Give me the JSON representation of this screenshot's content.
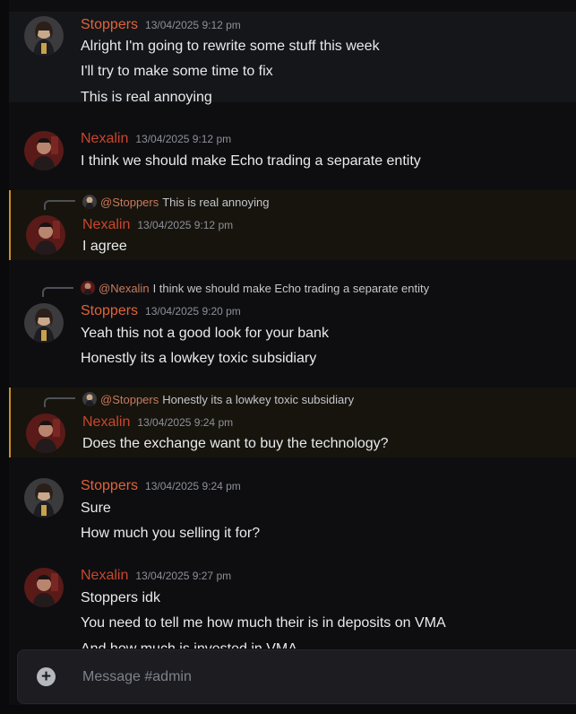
{
  "composer": {
    "placeholder": "Message #admin",
    "add_icon": "plus-circle-icon"
  },
  "messages": [
    {
      "author": "Stoppers",
      "timestamp": "13/04/2025 9:12 pm",
      "lines": [
        "Alright I'm going to rewrite some stuff this week",
        "I'll try to make some time to fix",
        "This is real annoying"
      ]
    },
    {
      "author": "Nexalin",
      "timestamp": "13/04/2025 9:12 pm",
      "lines": [
        "I think we should make Echo trading a separate entity"
      ]
    },
    {
      "reply_to": {
        "author": "@Stoppers",
        "text": "This is real annoying"
      },
      "author": "Nexalin",
      "timestamp": "13/04/2025 9:12 pm",
      "lines": [
        "I agree"
      ]
    },
    {
      "reply_to": {
        "author": "@Nexalin",
        "text": "I think we should make Echo trading a separate entity"
      },
      "author": "Stoppers",
      "timestamp": "13/04/2025 9:20 pm",
      "lines": [
        "Yeah this not a good look for your bank",
        "Honestly its a lowkey toxic subsidiary"
      ]
    },
    {
      "reply_to": {
        "author": "@Stoppers",
        "text": "Honestly its a lowkey toxic subsidiary"
      },
      "author": "Nexalin",
      "timestamp": "13/04/2025 9:24 pm",
      "lines": [
        "Does the exchange want to buy the technology?"
      ]
    },
    {
      "author": "Stoppers",
      "timestamp": "13/04/2025 9:24 pm",
      "lines": [
        "Sure",
        "How much you selling it for?"
      ]
    },
    {
      "author": "Nexalin",
      "timestamp": "13/04/2025 9:27 pm",
      "lines": [
        "Stoppers idk",
        "You need to tell me how much their is in deposits on VMA",
        "And how much is invested in VMA"
      ]
    }
  ]
}
